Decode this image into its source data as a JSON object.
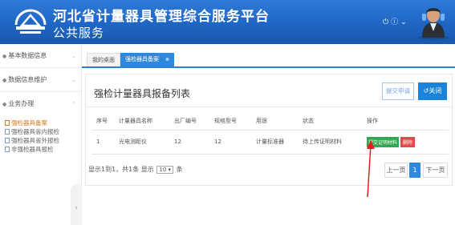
{
  "header": {
    "title": "河北省计量器具管理综合服务平台",
    "subtitle": "公共服务",
    "icons": [
      "power-icon",
      "info-icon",
      "chevron-down-icon"
    ]
  },
  "sidebar": {
    "items": [
      {
        "label": "基本数据信息"
      },
      {
        "label": "数据信息维护"
      },
      {
        "label": "业务办理"
      }
    ],
    "subitems": [
      {
        "label": "强检器具备案",
        "active": true
      },
      {
        "label": "强检器具省内报检",
        "active": false
      },
      {
        "label": "强检器具省外报检",
        "active": false
      },
      {
        "label": "非强检器具报检",
        "active": false
      }
    ]
  },
  "tabs": [
    {
      "label": "我的桌面"
    },
    {
      "label": "强检器具备案"
    }
  ],
  "panel": {
    "title": "强检计量器具报备列表",
    "submit_label": "提交申请",
    "close_label": "关闭"
  },
  "table": {
    "columns": [
      "序号",
      "计量器具名称",
      "出厂编号",
      "规格型号",
      "用途",
      "状态",
      "操作"
    ],
    "rows": [
      {
        "no": "1",
        "name": "光电测距仪",
        "serial": "12",
        "model": "12",
        "usage": "计量标准器",
        "status": "待上传证明材料",
        "action_submit": "提交证明材料",
        "action_delete": "删除"
      }
    ]
  },
  "pager": {
    "info_prefix": "显示1到1，共1条 显示",
    "page_size": "10",
    "info_suffix": "条",
    "prev": "上一页",
    "current": "1",
    "next": "下一页"
  },
  "colors": {
    "header_blue": "#1f66c4",
    "primary": "#2b8ae0",
    "submit_green": "#2fa84f",
    "delete_red": "#e04a4a",
    "active_orange": "#d87a1e",
    "annotation_red": "#e02020"
  }
}
